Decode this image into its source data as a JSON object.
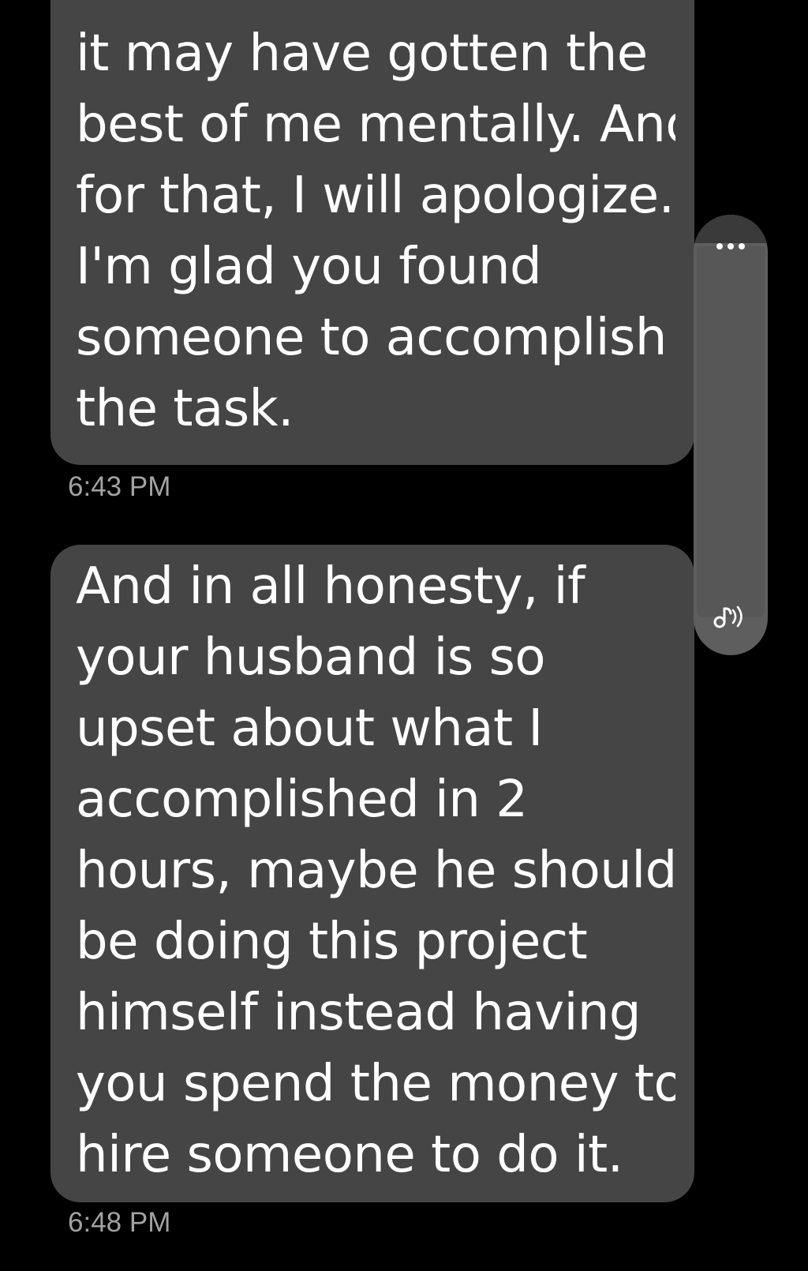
{
  "messages": [
    {
      "lines": [
        "it may have gotten the",
        "best of me mentally. And",
        "for that, I will apologize.",
        "I'm glad you found",
        "someone to accomplish",
        "the task."
      ],
      "time": "6:43 PM"
    },
    {
      "lines": [
        "And in all honesty, if",
        "your husband is so",
        "upset about what I",
        "accomplished in 2",
        "hours, maybe he should",
        "be doing this project",
        "himself instead having",
        "you spend the money to",
        "hire someone to do it."
      ],
      "time": "6:48 PM"
    }
  ],
  "side_panel": {
    "top_icon": "more-dots-icon",
    "bottom_icon": "audio-speaker-icon"
  },
  "colors": {
    "background": "#000000",
    "bubble": "#454545",
    "bubble_text": "#ffffff",
    "timestamp": "#a2a2a2",
    "side_panel": "#5e5e5e"
  }
}
